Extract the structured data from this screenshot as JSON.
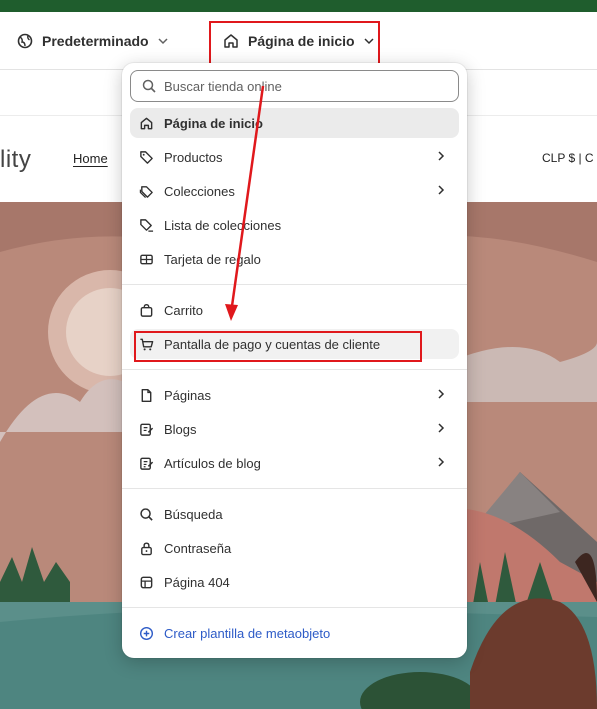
{
  "topbar": {
    "theme_label": "Predeterminado",
    "page_label": "Página de inicio"
  },
  "store": {
    "logo_fragment": "lity",
    "nav_home": "Home",
    "currency": "CLP $ | C"
  },
  "dropdown": {
    "search_placeholder": "Buscar tienda online",
    "items": [
      {
        "label": "Página de inicio",
        "icon": "home-icon",
        "active": true
      },
      {
        "label": "Productos",
        "icon": "tag-icon",
        "submenu": true
      },
      {
        "label": "Colecciones",
        "icon": "tags-icon",
        "submenu": true
      },
      {
        "label": "Lista de colecciones",
        "icon": "tag-list-icon"
      },
      {
        "label": "Tarjeta de regalo",
        "icon": "gift-card-icon"
      },
      {
        "label": "Carrito",
        "icon": "bag-icon"
      },
      {
        "label": "Pantalla de pago y cuentas de cliente",
        "icon": "cart-icon",
        "highlighted": true
      },
      {
        "label": "Páginas",
        "icon": "page-icon",
        "submenu": true
      },
      {
        "label": "Blogs",
        "icon": "blog-icon",
        "submenu": true
      },
      {
        "label": "Artículos de blog",
        "icon": "blog-post-icon",
        "submenu": true
      },
      {
        "label": "Búsqueda",
        "icon": "search-icon"
      },
      {
        "label": "Contraseña",
        "icon": "lock-icon"
      },
      {
        "label": "Página 404",
        "icon": "layout-icon"
      }
    ],
    "create_label": "Crear plantilla de metaobjeto"
  },
  "colors": {
    "accent_stripe": "#1f5d2d",
    "annotation_red": "#e0181c",
    "link_blue": "#2d5bc7"
  }
}
